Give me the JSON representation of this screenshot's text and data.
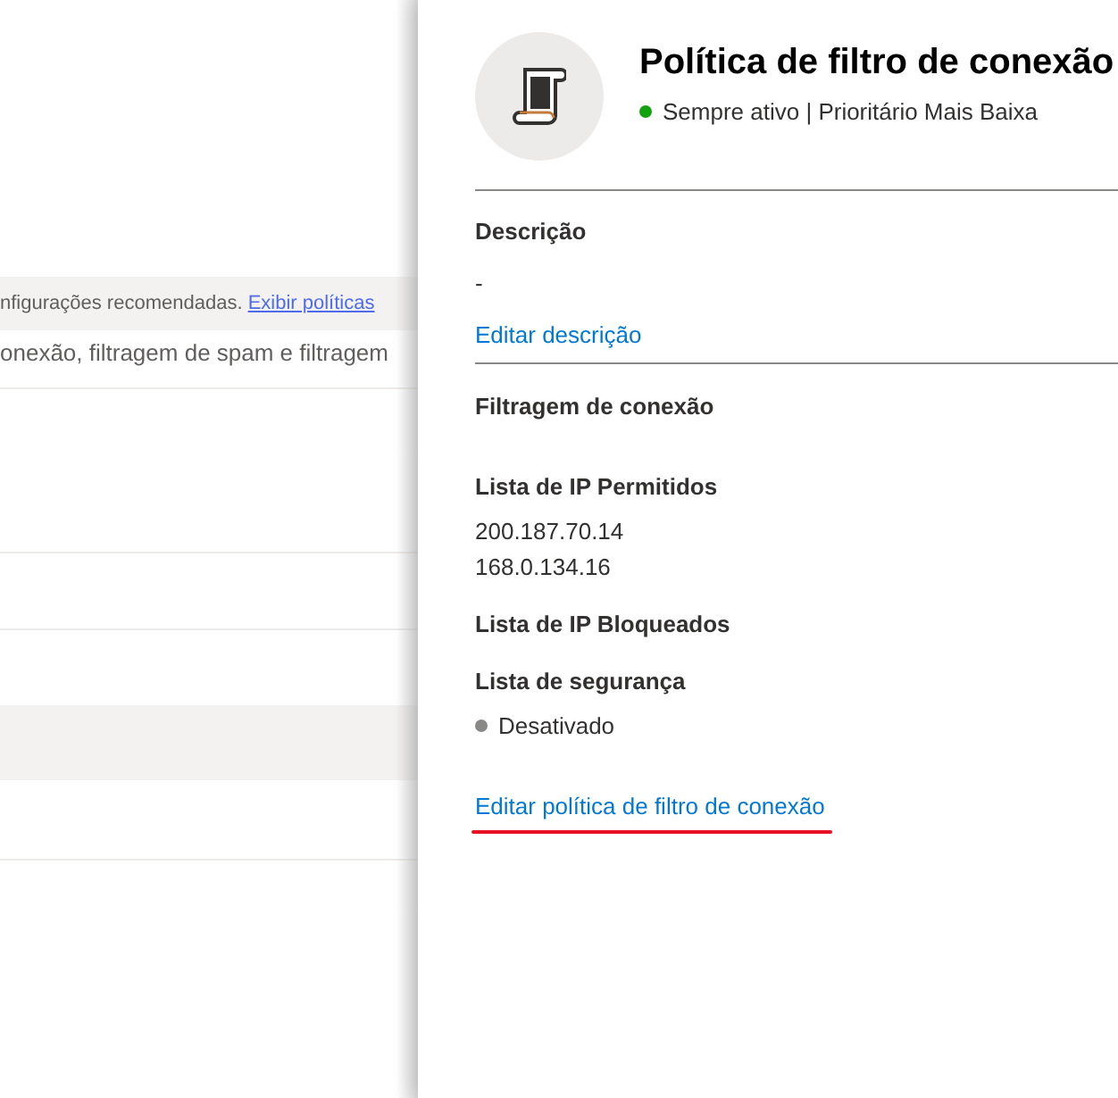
{
  "background": {
    "notice": "nfigurações recomendadas.",
    "notice_link": "Exibir políticas",
    "description": "onexão, filtragem de spam e filtragem"
  },
  "panel": {
    "title": "Política de filtro de conexão",
    "status": {
      "text": "Sempre ativo | Prioritário Mais Baixa",
      "color": "#13a10e"
    },
    "description_section": {
      "heading": "Descrição",
      "value": "-",
      "link": "Editar descrição"
    },
    "filtering_section": {
      "heading": "Filtragem de conexão",
      "groups": [
        {
          "heading": "Lista de IP Permitidos",
          "items": [
            "200.187.70.14",
            "168.0.134.16"
          ]
        },
        {
          "heading": "Lista de IP Bloqueados"
        },
        {
          "heading": "Lista de segurança",
          "status": {
            "text": "Desativado",
            "color": "#8a8886"
          }
        }
      ]
    },
    "edit_link": "Editar política de filtro de conexão"
  }
}
